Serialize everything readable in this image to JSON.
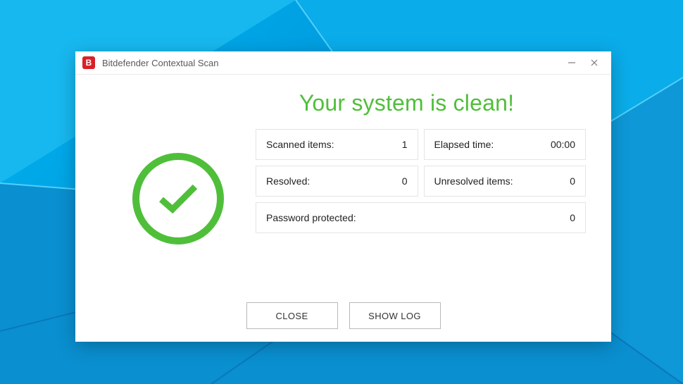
{
  "window": {
    "title": "Bitdefender Contextual Scan",
    "app_icon_letter": "B"
  },
  "heading": "Your system is clean!",
  "stats": {
    "scanned_items": {
      "label": "Scanned items:",
      "value": "1"
    },
    "elapsed_time": {
      "label": "Elapsed time:",
      "value": "00:00"
    },
    "resolved": {
      "label": "Resolved:",
      "value": "0"
    },
    "unresolved_items": {
      "label": "Unresolved items:",
      "value": "0"
    },
    "password_protected": {
      "label": "Password protected:",
      "value": "0"
    }
  },
  "buttons": {
    "close": "CLOSE",
    "show_log": "SHOW LOG"
  },
  "colors": {
    "accent_green": "#4fbf3a",
    "brand_red": "#d92027"
  }
}
